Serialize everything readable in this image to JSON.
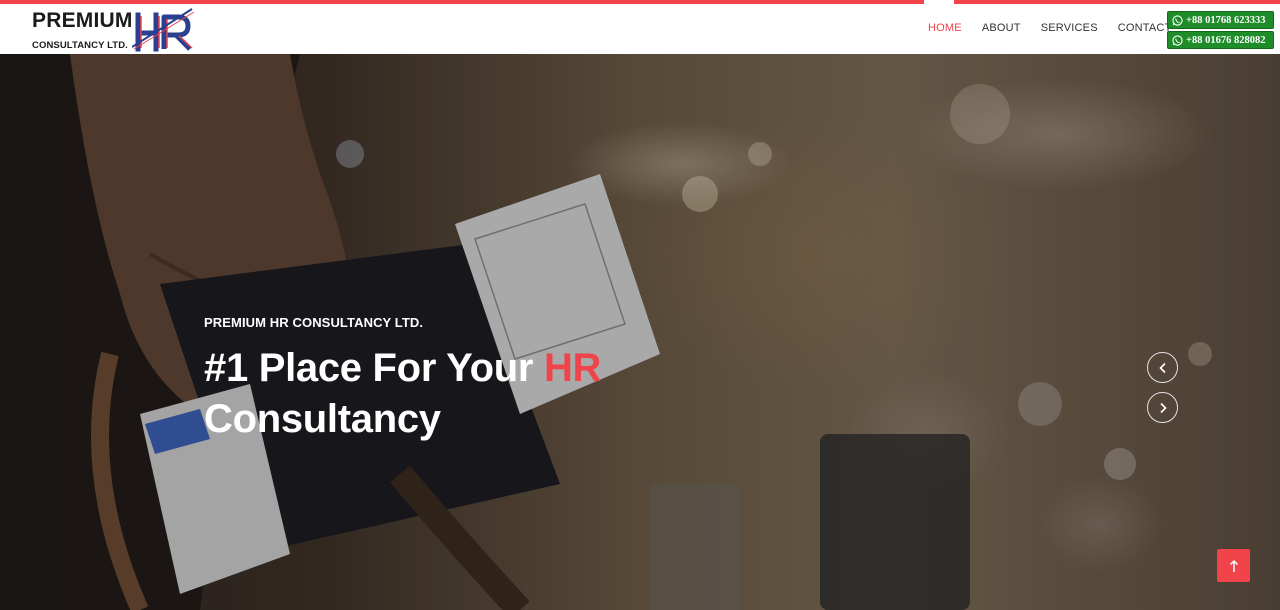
{
  "brand": {
    "name": "PREMIUM",
    "tagline": "CONSULTANCY LTD.",
    "mark": "HR",
    "accent_color": "#f0434a",
    "mark_blue": "#2a3f8f"
  },
  "nav": {
    "items": [
      {
        "label": "HOME",
        "active": true
      },
      {
        "label": "ABOUT",
        "active": false
      },
      {
        "label": "SERVICES",
        "active": false
      },
      {
        "label": "CONTACT",
        "active": false
      }
    ]
  },
  "contact": {
    "icon": "whatsapp-icon",
    "phones": [
      "+88 01768 623333",
      "+88 01676 828082"
    ],
    "button_color": "#1f8c2a"
  },
  "hero": {
    "kicker": "PREMIUM HR CONSULTANCY LTD.",
    "title_part1": "#1 Place For Your ",
    "title_highlight": "HR",
    "title_part2": "Consultancy",
    "prev_icon": "chevron-left-icon",
    "next_icon": "chevron-right-icon",
    "background": "airport-boarding-pass-photo"
  },
  "back_to_top": {
    "icon": "arrow-up-icon"
  }
}
